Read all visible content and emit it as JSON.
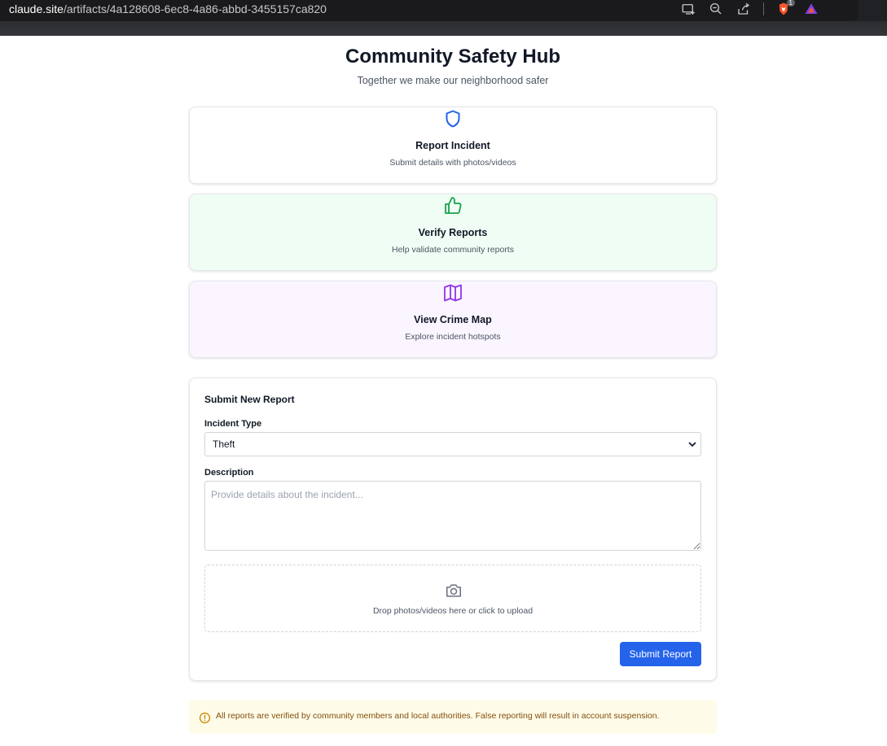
{
  "browser": {
    "url_host": "claude.site",
    "url_path": "/artifacts/4a128608-6ec8-4a86-abbd-3455157ca820",
    "brave_badge": "1",
    "icons": [
      "install-app-icon",
      "zoom-out-icon",
      "share-icon",
      "brave-shields-icon",
      "brave-rewards-icon"
    ]
  },
  "header": {
    "title": "Community Safety Hub",
    "subtitle": "Together we make our neighborhood safer"
  },
  "cards": [
    {
      "title": "Report Incident",
      "description": "Submit details with photos/videos",
      "icon": "shield-icon",
      "color": "#2563eb",
      "background": "#ffffff"
    },
    {
      "title": "Verify Reports",
      "description": "Help validate community reports",
      "icon": "thumbs-up-icon",
      "color": "#16a34a",
      "background": "#f0fdf4"
    },
    {
      "title": "View Crime Map",
      "description": "Explore incident hotspots",
      "icon": "map-icon",
      "color": "#9333ea",
      "background": "#faf5ff"
    }
  ],
  "form": {
    "title": "Submit New Report",
    "incident_type_label": "Incident Type",
    "incident_type_value": "Theft",
    "description_label": "Description",
    "description_placeholder": "Provide details about the incident...",
    "upload_text": "Drop photos/videos here or click to upload",
    "submit_label": "Submit Report",
    "accent": "#2563eb"
  },
  "notice": {
    "text": "All reports are verified by community members and local authorities. False reporting will result in account suspension.",
    "color": "#ca8a04"
  }
}
